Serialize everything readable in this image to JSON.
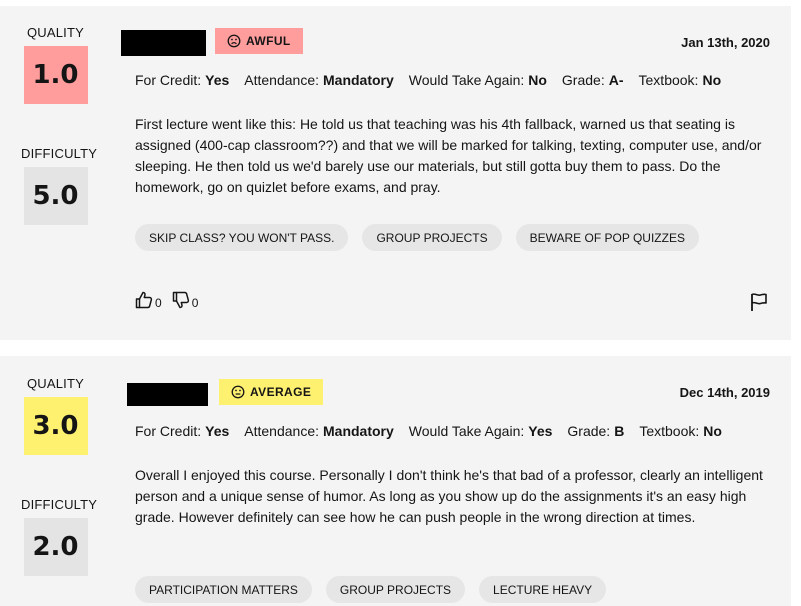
{
  "ratings": [
    {
      "quality_label": "QUALITY",
      "quality": "1.0",
      "difficulty_label": "DIFFICULTY",
      "difficulty": "5.0",
      "emotion": "AWFUL",
      "emotion_icon": "sad-face-icon",
      "date": "Jan 13th, 2020",
      "meta": [
        {
          "label": "For Credit:",
          "value": "Yes"
        },
        {
          "label": "Attendance:",
          "value": "Mandatory"
        },
        {
          "label": "Would Take Again:",
          "value": "No"
        },
        {
          "label": "Grade:",
          "value": "A-"
        },
        {
          "label": "Textbook:",
          "value": "No"
        }
      ],
      "comment": "First lecture went like this: He told us that teaching was his 4th fallback, warned us that seating is assigned (400-cap classroom??) and that we will be marked for talking, texting, computer use, and/or sleeping. He then told us we'd barely use our materials, but still gotta buy them to pass. Do the homework, go on quizlet before exams, and pray.",
      "tags": [
        "SKIP CLASS? YOU WON'T PASS.",
        "GROUP PROJECTS",
        "BEWARE OF POP QUIZZES"
      ],
      "helpful_count": "0",
      "not_helpful_count": "0"
    },
    {
      "quality_label": "QUALITY",
      "quality": "3.0",
      "difficulty_label": "DIFFICULTY",
      "difficulty": "2.0",
      "emotion": "AVERAGE",
      "emotion_icon": "neutral-face-icon",
      "date": "Dec 14th, 2019",
      "meta": [
        {
          "label": "For Credit:",
          "value": "Yes"
        },
        {
          "label": "Attendance:",
          "value": "Mandatory"
        },
        {
          "label": "Would Take Again:",
          "value": "Yes"
        },
        {
          "label": "Grade:",
          "value": "B"
        },
        {
          "label": "Textbook:",
          "value": "No"
        }
      ],
      "comment": "Overall I enjoyed this course. Personally I don't think he's that bad of a professor, clearly an intelligent person and a unique sense of humor. As long as you show up do the assignments it's an easy high grade. However definitely can see how he can push people in the wrong direction at times.",
      "tags": [
        "PARTICIPATION MATTERS",
        "GROUP PROJECTS",
        "LECTURE HEAVY"
      ]
    }
  ],
  "colors": {
    "awful": "#ff9c9c",
    "average": "#fff170",
    "difficulty_box": "#e4e4e4",
    "card_bg": "#f4f4f4",
    "tag_bg": "#e6e6e6"
  },
  "icons": {
    "thumbs_up": "thumbs-up-icon",
    "thumbs_down": "thumbs-down-icon",
    "flag": "flag-icon"
  }
}
